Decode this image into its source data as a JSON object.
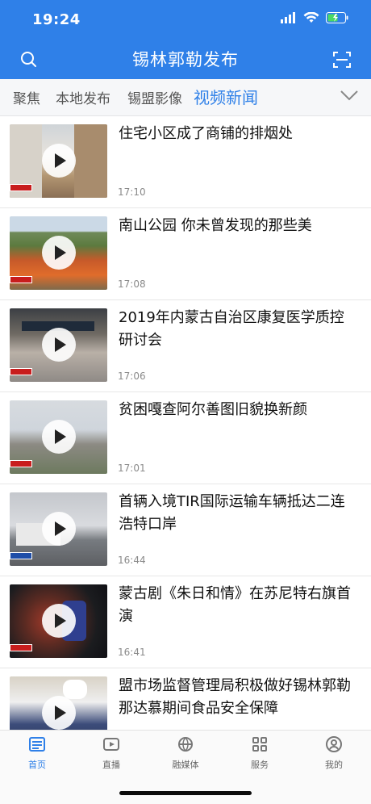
{
  "status_bar": {
    "time": "19:24",
    "icons": [
      "signal-icon",
      "wifi-icon",
      "battery-icon"
    ]
  },
  "nav": {
    "title": "锡林郭勒发布",
    "left_icon": "search-icon",
    "right_icon": "scan-icon"
  },
  "tabs": [
    {
      "label": "聚焦"
    },
    {
      "label": "本地发布"
    },
    {
      "label": "锡盟影像"
    },
    {
      "label": "视频新闻",
      "active": true
    }
  ],
  "tab_more_icon": "chevron-down-icon",
  "news": [
    {
      "title": "住宅小区成了商铺的排烟处",
      "time": "17:10"
    },
    {
      "title": "南山公园 你未曾发现的那些美",
      "time": "17:08"
    },
    {
      "title": "2019年内蒙古自治区康复医学质控研讨会",
      "time": "17:06"
    },
    {
      "title": "贫困嘎查阿尔善图旧貌换新颜",
      "time": "17:01"
    },
    {
      "title": "首辆入境TIR国际运输车辆抵达二连浩特口岸",
      "time": "16:44"
    },
    {
      "title": "蒙古剧《朱日和情》在苏尼特右旗首演",
      "time": "16:41"
    },
    {
      "title": "盟市场监督管理局积极做好锡林郭勒那达慕期间食品安全保障",
      "time": ""
    }
  ],
  "bottom_nav": [
    {
      "label": "首页",
      "icon": "news-icon",
      "active": true
    },
    {
      "label": "直播",
      "icon": "play-icon"
    },
    {
      "label": "融媒体",
      "icon": "globe-icon"
    },
    {
      "label": "服务",
      "icon": "grid-icon"
    },
    {
      "label": "我的",
      "icon": "user-icon"
    }
  ],
  "colors": {
    "brand_blue": "#2f80e8",
    "text_dark": "#111111",
    "text_gray": "#8a8a8a"
  }
}
